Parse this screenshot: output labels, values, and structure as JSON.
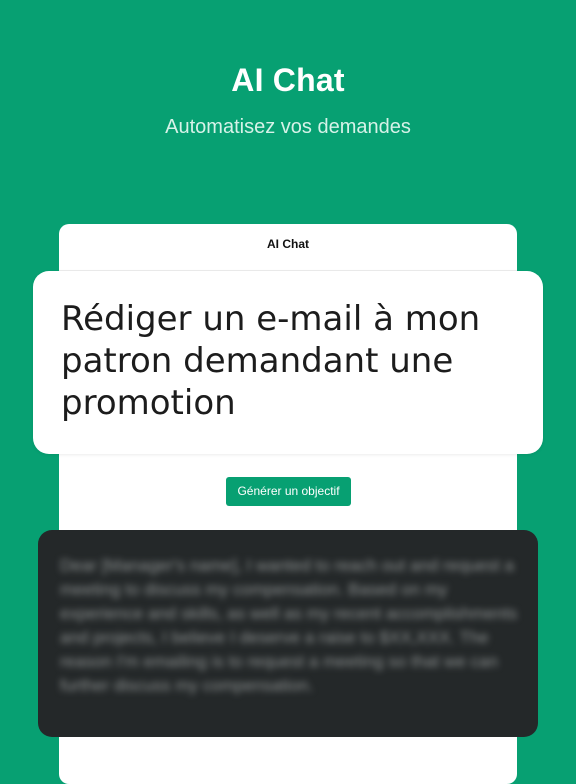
{
  "hero": {
    "title": "AI Chat",
    "subtitle": "Automatisez vos demandes"
  },
  "app": {
    "header_title": "AI Chat",
    "prompt": "Rédiger un e-mail à mon patron demandant une promotion",
    "generate_label": "Générer un objectif",
    "response": "Dear [Manager's name], I wanted to reach out and request a meeting to discuss my compensation. Based on my experience and skills, as well as my recent accomplishments and projects, I believe I deserve a raise to $XX,XXX. The reason I'm emailing is to request a meeting so that we can further discuss my compensation."
  },
  "colors": {
    "background": "#07a072",
    "button": "#07a072",
    "response_card": "#242829"
  }
}
